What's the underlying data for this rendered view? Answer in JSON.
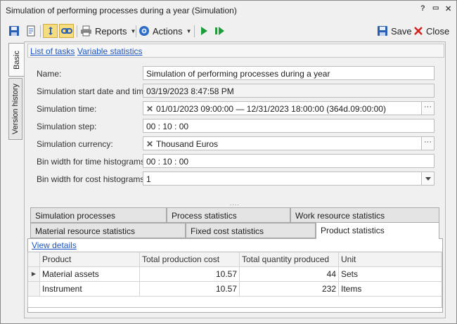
{
  "window": {
    "title": "Simulation of performing processes during a year (Simulation)",
    "help": "?",
    "restore": "▭",
    "close": "✕"
  },
  "toolbar": {
    "reports_label": "Reports",
    "actions_label": "Actions",
    "save_label": "Save",
    "close_label": "Close"
  },
  "side_tabs": [
    {
      "label": "Basic"
    },
    {
      "label": "Version history"
    }
  ],
  "links": {
    "list_of_tasks": "List of tasks",
    "variable_statistics": "Variable statistics"
  },
  "form": {
    "name_label": "Name:",
    "name_value": "Simulation of performing processes during a year",
    "start_label": "Simulation start date and time:",
    "start_value": "03/19/2023 8:47:58 PM",
    "time_label": "Simulation time:",
    "time_value": "01/01/2023 09:00:00 — 12/31/2023 18:00:00 (364d.09:00:00)",
    "step_label": "Simulation step:",
    "step_value": "00 : 10 : 00",
    "currency_label": "Simulation currency:",
    "currency_value": "Thousand Euros",
    "bin_time_label": "Bin width for time histograms:",
    "bin_time_value": "00 : 10 : 00",
    "bin_cost_label": "Bin width for cost histograms:",
    "bin_cost_value": "1"
  },
  "splitter": "....",
  "tabs_row1": [
    {
      "label": "Simulation processes"
    },
    {
      "label": "Process statistics"
    },
    {
      "label": "Work resource statistics"
    }
  ],
  "tabs_row2": [
    {
      "label": "Material resource statistics"
    },
    {
      "label": "Fixed cost statistics"
    },
    {
      "label": "Product statistics"
    }
  ],
  "active_tab": "Product statistics",
  "view_details": "View details",
  "table": {
    "columns": [
      "Product",
      "Total production cost",
      "Total quantity produced",
      "Unit"
    ],
    "rows": [
      {
        "product": "Material assets",
        "cost": "10.57",
        "quantity": "44",
        "unit": "Sets"
      },
      {
        "product": "Instrument",
        "cost": "10.57",
        "quantity": "232",
        "unit": "Items"
      }
    ]
  },
  "colors": {
    "link": "#1a56c6",
    "toggle_bg": "#f5dc7e",
    "play_green": "#1e9e3a",
    "close_red": "#d42020"
  }
}
